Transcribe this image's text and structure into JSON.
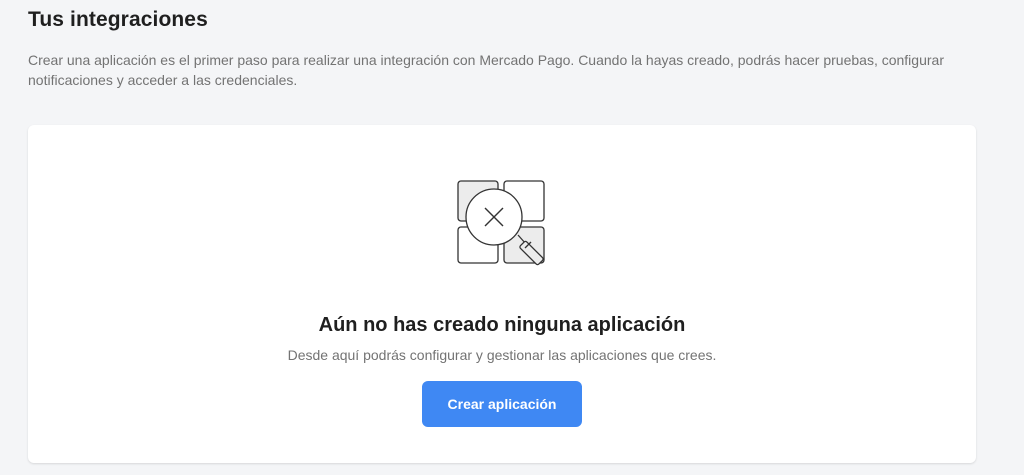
{
  "header": {
    "title": "Tus integraciones",
    "description": "Crear una aplicación es el primer paso para realizar una integración con Mercado Pago. Cuando la hayas creado, podrás hacer pruebas, configurar notificaciones y acceder a las credenciales."
  },
  "empty_state": {
    "illustration_icon": "grid-search-no-results-icon",
    "title": "Aún no has creado ninguna aplicación",
    "subtitle": "Desde aquí podrás configurar y gestionar las aplicaciones que crees.",
    "button_label": "Crear aplicación"
  },
  "colors": {
    "background": "#f4f5f7",
    "card": "#ffffff",
    "primary_button": "#3f88f3",
    "text_primary": "#1f1f1f",
    "text_secondary": "#737373"
  }
}
